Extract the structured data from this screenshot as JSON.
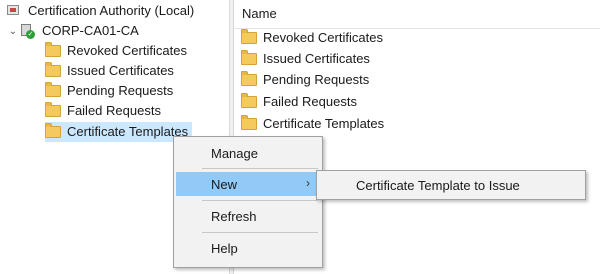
{
  "tree": {
    "root_label": "Certification Authority (Local)",
    "ca_label": "CORP-CA01-CA",
    "ca_expander": "⌄",
    "children": [
      {
        "label": "Revoked Certificates"
      },
      {
        "label": "Issued Certificates"
      },
      {
        "label": "Pending Requests"
      },
      {
        "label": "Failed Requests"
      },
      {
        "label": "Certificate Templates"
      }
    ],
    "selected_index": 4
  },
  "list": {
    "header": "Name",
    "items": [
      {
        "label": "Revoked Certificates"
      },
      {
        "label": "Issued Certificates"
      },
      {
        "label": "Pending Requests"
      },
      {
        "label": "Failed Requests"
      },
      {
        "label": "Certificate Templates"
      }
    ]
  },
  "context_menu": {
    "items": [
      {
        "label": "Manage"
      },
      {
        "label": "New",
        "has_submenu": true,
        "arrow": "›"
      },
      {
        "label": "Refresh"
      },
      {
        "label": "Help"
      }
    ],
    "hovered": "New"
  },
  "submenu": {
    "items": [
      {
        "label": "Certificate Template to Issue"
      }
    ]
  },
  "colors": {
    "selection": "#cce8ff",
    "menu_hover": "#91c9f7",
    "folder": "#f4c95d"
  },
  "icons": {
    "root": "certification-authority-icon",
    "ca": "ca-server-icon",
    "folder": "folder-icon"
  }
}
